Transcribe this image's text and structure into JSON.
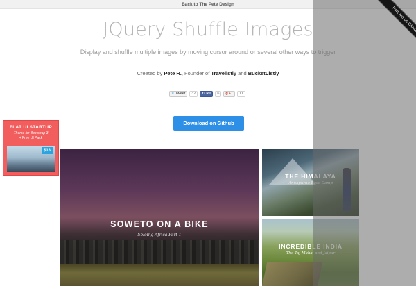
{
  "topbar": {
    "back_link": "Back to The Pete Design"
  },
  "ribbon": {
    "label": "Fork me on GitHub"
  },
  "header": {
    "title": "JQuery Shuffle Images",
    "subtitle": "Display and shuffle multiple images by moving cursor around or several other ways to trigger"
  },
  "credit": {
    "prefix": "Created by ",
    "author": "Pete R.",
    "middle": ", Founder of ",
    "company1": "Travelistly",
    "and": " and ",
    "company2": "BucketListly"
  },
  "social": {
    "tweet_label": "Tweet",
    "tweet_count": "32",
    "like_label": "Like",
    "like_count": "6",
    "gplus_label": "+1",
    "gplus_count": "11"
  },
  "download_button": "Download on Github",
  "ad": {
    "line1": "FLAT UI STARTUP",
    "line2": "Theme for Bootstrap 3",
    "line3": "+ Free UI Pack",
    "price": "$13"
  },
  "cards": [
    {
      "title": "SOWETO ON A BIKE",
      "subtitle": "Soloing Africa Part 1"
    },
    {
      "title": "THE HIMALAYA",
      "subtitle": "Annapurna Base Camp"
    },
    {
      "title": "INCREDIBLE INDIA",
      "subtitle": "The Taj Mahal and Jaipur"
    }
  ]
}
